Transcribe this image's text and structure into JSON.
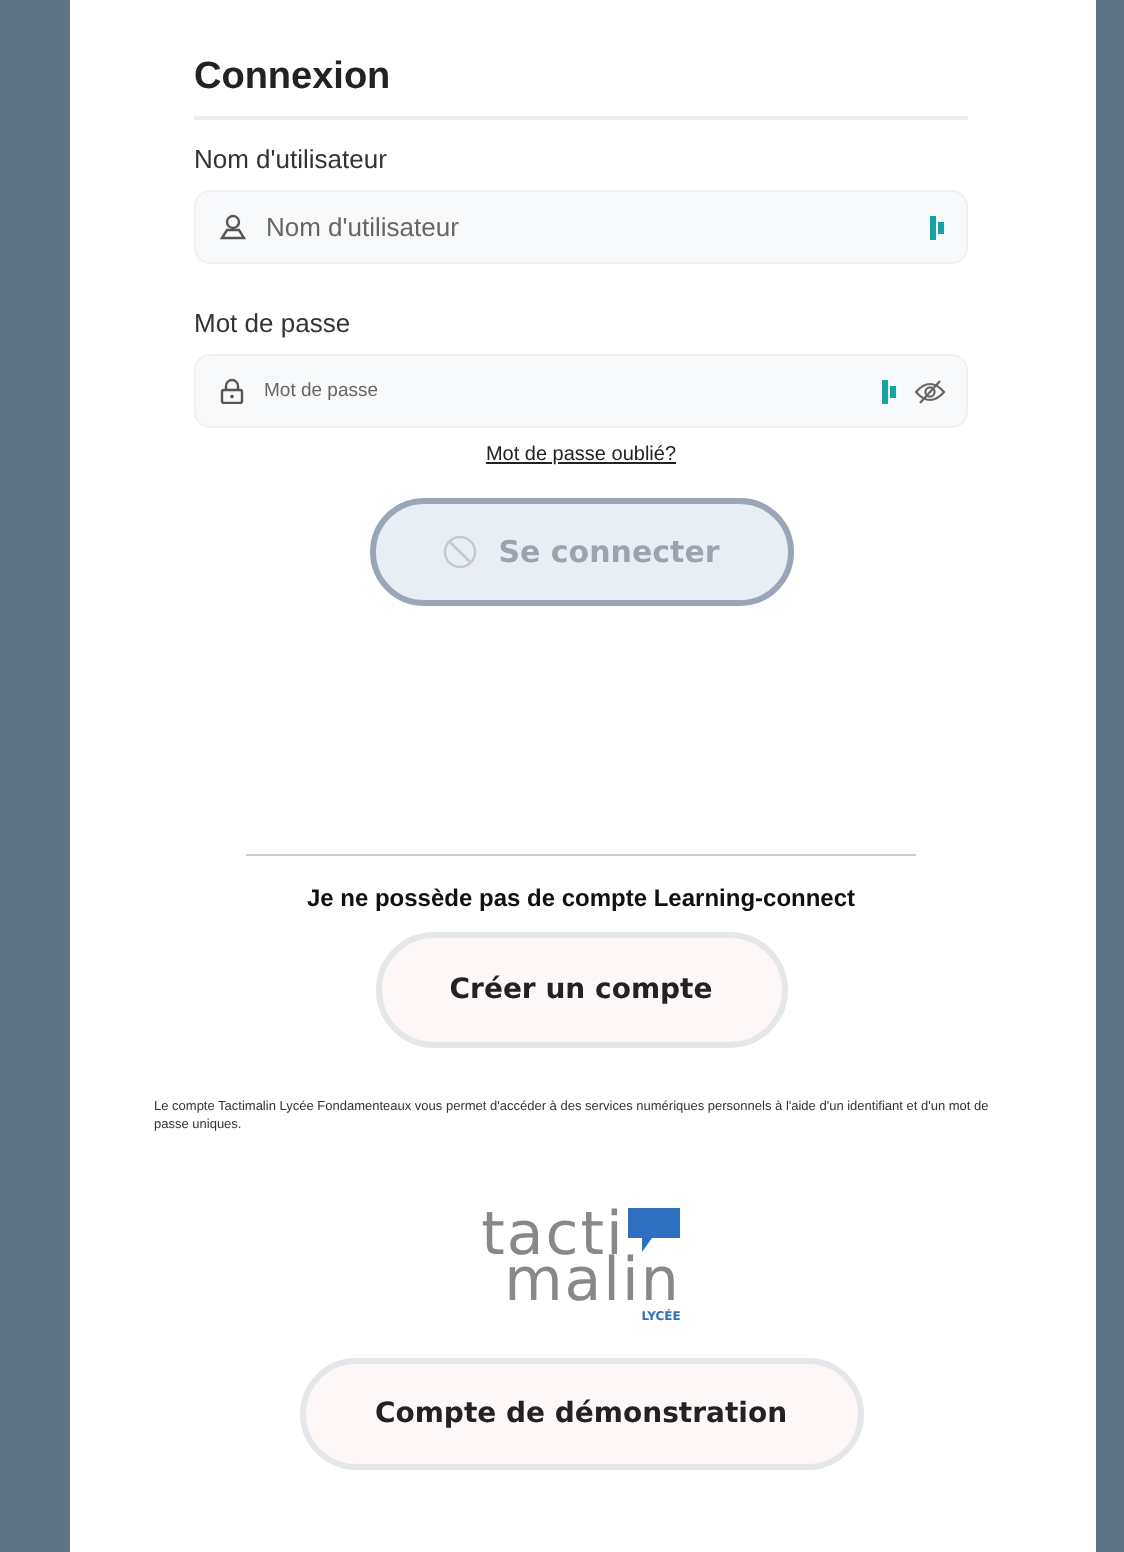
{
  "title": "Connexion",
  "fields": [
    {
      "label": "Nom d'utilisateur",
      "placeholder": "Nom d'utilisateur",
      "kind": "user",
      "password_toggle": false
    },
    {
      "label": "Mot de passe",
      "placeholder": "Mot de passe",
      "kind": "password",
      "password_toggle": true
    }
  ],
  "forgot_link": "Mot de passe oublié?",
  "login_button": {
    "label": "Se connecter",
    "disabled": true
  },
  "no_account_heading": "Je ne possède pas de compte Learning-connect",
  "create_button": "Créer un compte",
  "info_text": "Le compte Tactimalin Lycée Fondamenteaux vous permet d'accéder à des services numériques personnels à l'aide d'un identifiant et d'un mot de passe uniques.",
  "logo": {
    "line_1": "tacti",
    "line_2": "malin",
    "tag": "LYCÉE"
  },
  "demo_button": "Compte de démonstration"
}
